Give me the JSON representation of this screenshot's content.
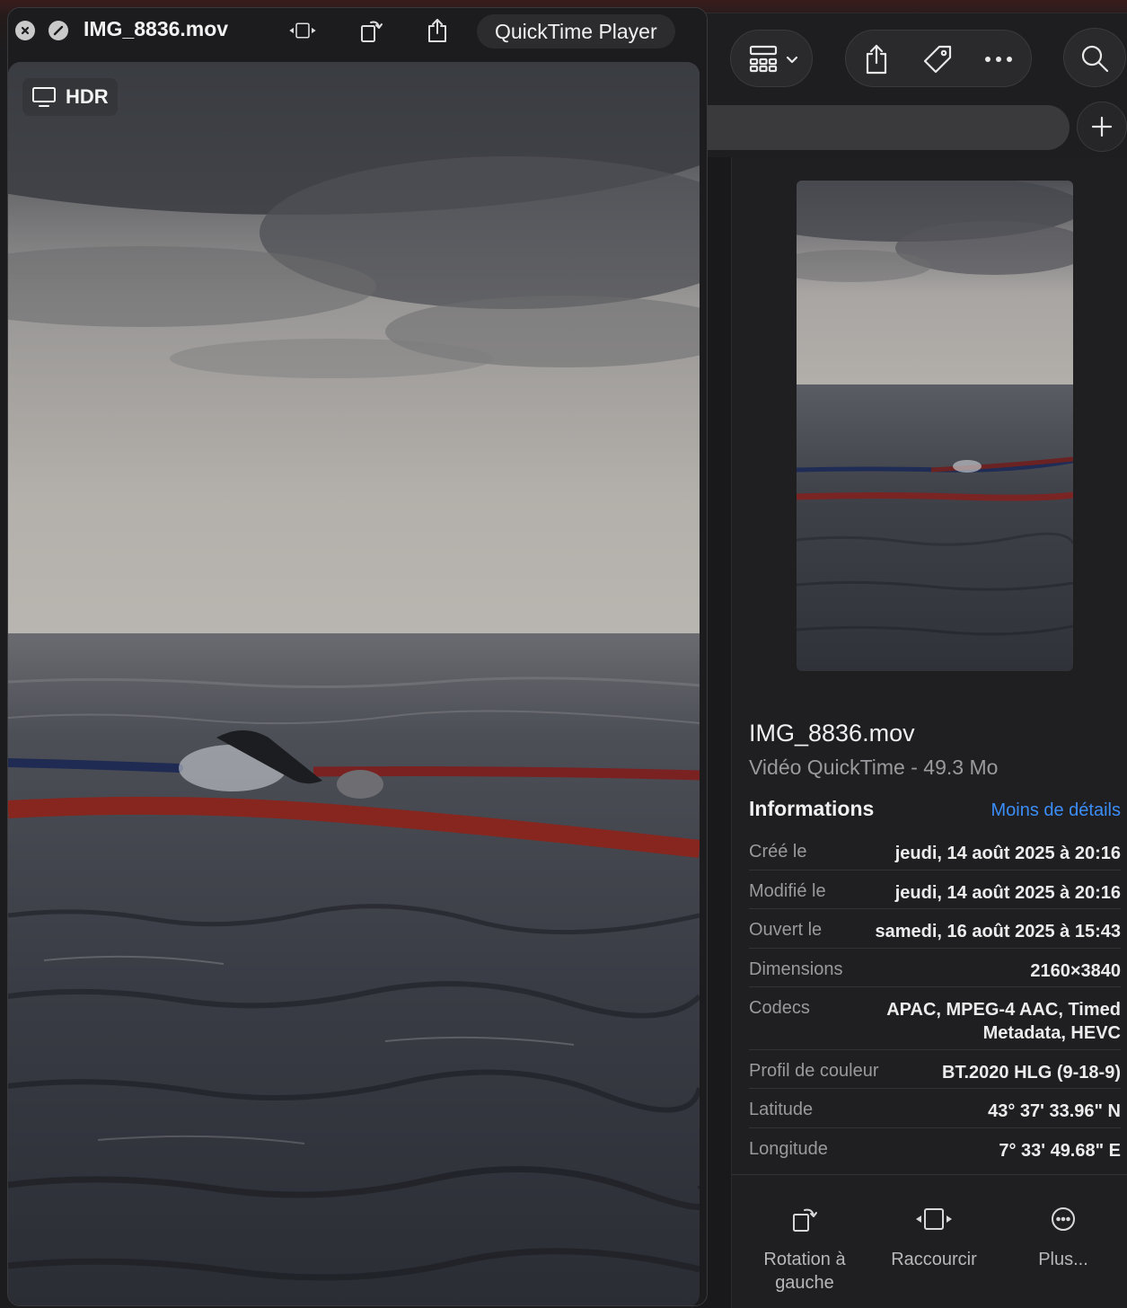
{
  "quicktime": {
    "file_name": "IMG_8836.mov",
    "open_with_label": "QuickTime Player",
    "hdr_badge": "HDR"
  },
  "inspector": {
    "title": "IMG_8836.mov",
    "subtitle": "Vidéo QuickTime - 49.3 Mo",
    "section_title": "Informations",
    "toggle_details": "Moins de détails",
    "rows": [
      {
        "key": "Créé le",
        "value": "jeudi, 14 août 2025 à 20:16"
      },
      {
        "key": "Modifié le",
        "value": "jeudi, 14 août 2025 à 20:16"
      },
      {
        "key": "Ouvert le",
        "value": "samedi, 16 août 2025 à 15:43"
      },
      {
        "key": "Dimensions",
        "value": "2160×3840"
      },
      {
        "key": "Codecs",
        "value": "APAC, MPEG-4 AAC, Timed\nMetadata, HEVC"
      },
      {
        "key": "Profil de couleur",
        "value": "BT.2020 HLG (9-18-9)"
      },
      {
        "key": "Latitude",
        "value": "43° 37' 33.96\" N"
      },
      {
        "key": "Longitude",
        "value": "7° 33' 49.68\" E"
      }
    ],
    "actions": [
      {
        "label": "Rotation à gauche",
        "icon": "rotate-left-icon"
      },
      {
        "label": "Raccourcir",
        "icon": "trim-icon"
      },
      {
        "label": "Plus...",
        "icon": "more-circle-icon"
      }
    ]
  },
  "colors": {
    "accent_link": "#3b8df7",
    "window_bg": "#1e1e20"
  }
}
